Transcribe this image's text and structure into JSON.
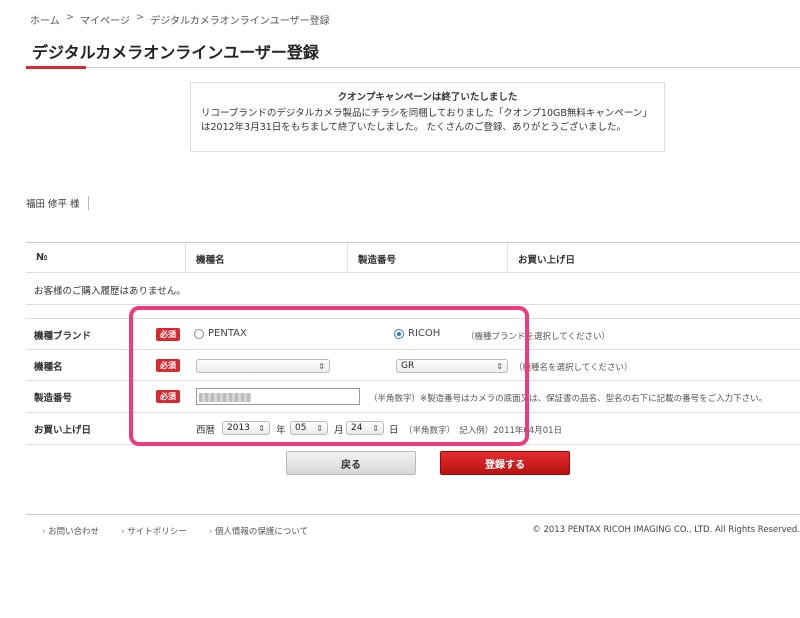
{
  "breadcrumb": {
    "home": "ホーム",
    "sep1": ">",
    "mypage": "マイページ",
    "sep2": ">",
    "current": "デジタルカメラオンラインユーザー登録"
  },
  "page_title": "デジタルカメラオンラインユーザー登録",
  "notice": {
    "title": "クオンプキャンペーンは終了いたしました",
    "body": "リコーブランドのデジタルカメラ製品にチラシを同梱しておりました「クオンプ10GB無料キャンペーン」は2012年3月31日をもちまして終了いたしました。 たくさんのご登録、ありがとうございました。"
  },
  "user_name": "福田 修平 様",
  "history_table": {
    "headers": [
      "№",
      "機種名",
      "製造番号",
      "お買い上げ日"
    ],
    "empty_message": "お客様のご購入履歴はありません。"
  },
  "form": {
    "required_label": "必須",
    "brand": {
      "label": "機種ブランド",
      "options": [
        "PENTAX",
        "RICOH"
      ],
      "selected": "RICOH",
      "hint": "（機種ブランドを選択してください）"
    },
    "model": {
      "label": "機種名",
      "pentax_value": "",
      "ricoh_value": "GR",
      "hint": "（機種名を選択してください）"
    },
    "serial": {
      "label": "製造番号",
      "hint": "（半角数字）※製造番号はカメラの底面又は、保証書の品名、型名の右下に記載の番号をご入力下さい。"
    },
    "purchase_date": {
      "label": "お買い上げ日",
      "era": "西暦",
      "year": "2013",
      "year_unit": "年",
      "month": "05",
      "month_unit": "月",
      "day": "24",
      "day_unit": "日",
      "hint": "（半角数字）　記入例）2011年04月01日"
    }
  },
  "buttons": {
    "back": "戻る",
    "register": "登録する"
  },
  "footer": {
    "links": [
      "お問い合わせ",
      "サイトポリシー",
      "個人情報の保護について"
    ],
    "copyright": "© 2013 PENTAX RICOH IMAGING CO., LTD. All Rights Reserved."
  },
  "colors": {
    "accent_red": "#d9282e",
    "highlight_pink": "#ee3b7b"
  }
}
